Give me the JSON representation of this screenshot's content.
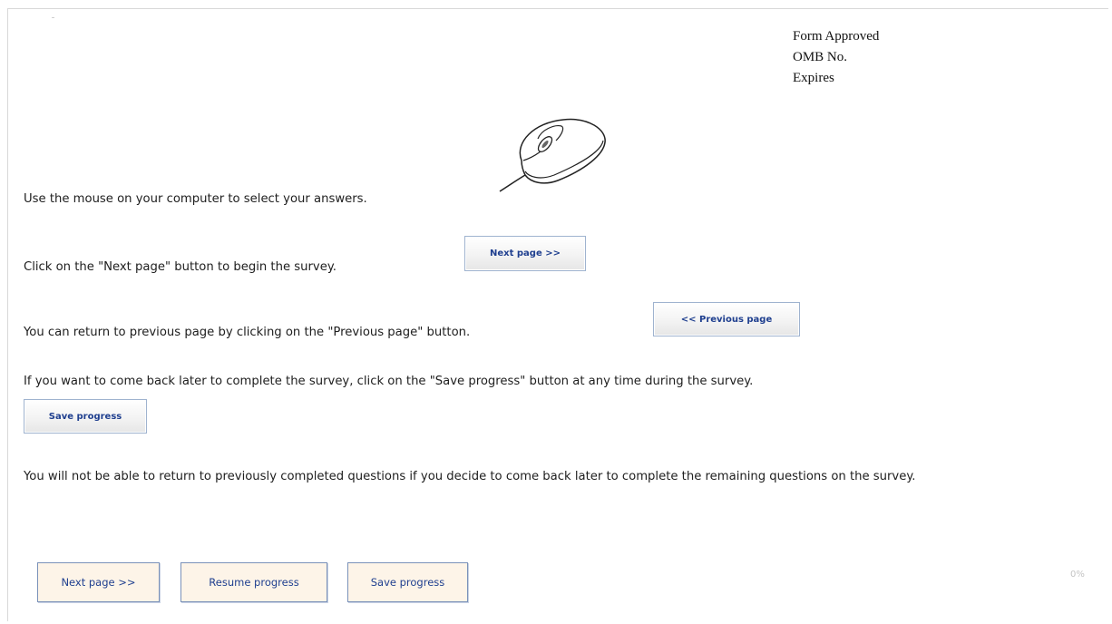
{
  "omb_block": {
    "line1": "Form Approved",
    "line2": "OMB No.",
    "line3": "Expires"
  },
  "instructions": {
    "mouse_text": "Use the mouse on your computer to select your answers.",
    "next_text": "Click on the \"Next page\" button to begin the survey.",
    "previous_text": "You can return to previous page by clicking on the \"Previous page\" button.",
    "save_text": "If you want to come back later to complete the survey, click on the \"Save progress\" button at any time during the survey.",
    "warning_text": "You will not be able to return to previously completed questions if you decide to come back later to complete the remaining questions on the survey."
  },
  "inline_buttons": {
    "next_label": "Next page >>",
    "previous_label": "<< Previous page",
    "save_label": "Save progress"
  },
  "nav_buttons": {
    "next_label": "Next page >>",
    "resume_label": "Resume progress",
    "save_label": "Save progress"
  },
  "progress": {
    "text": "0%",
    "value": 0
  },
  "icons": {
    "mouse": "computer-mouse-icon"
  },
  "colors": {
    "button_text": "#1f3f8f",
    "button_border": "#7a91b9",
    "bottom_button_bg": "#fdf4e8"
  }
}
